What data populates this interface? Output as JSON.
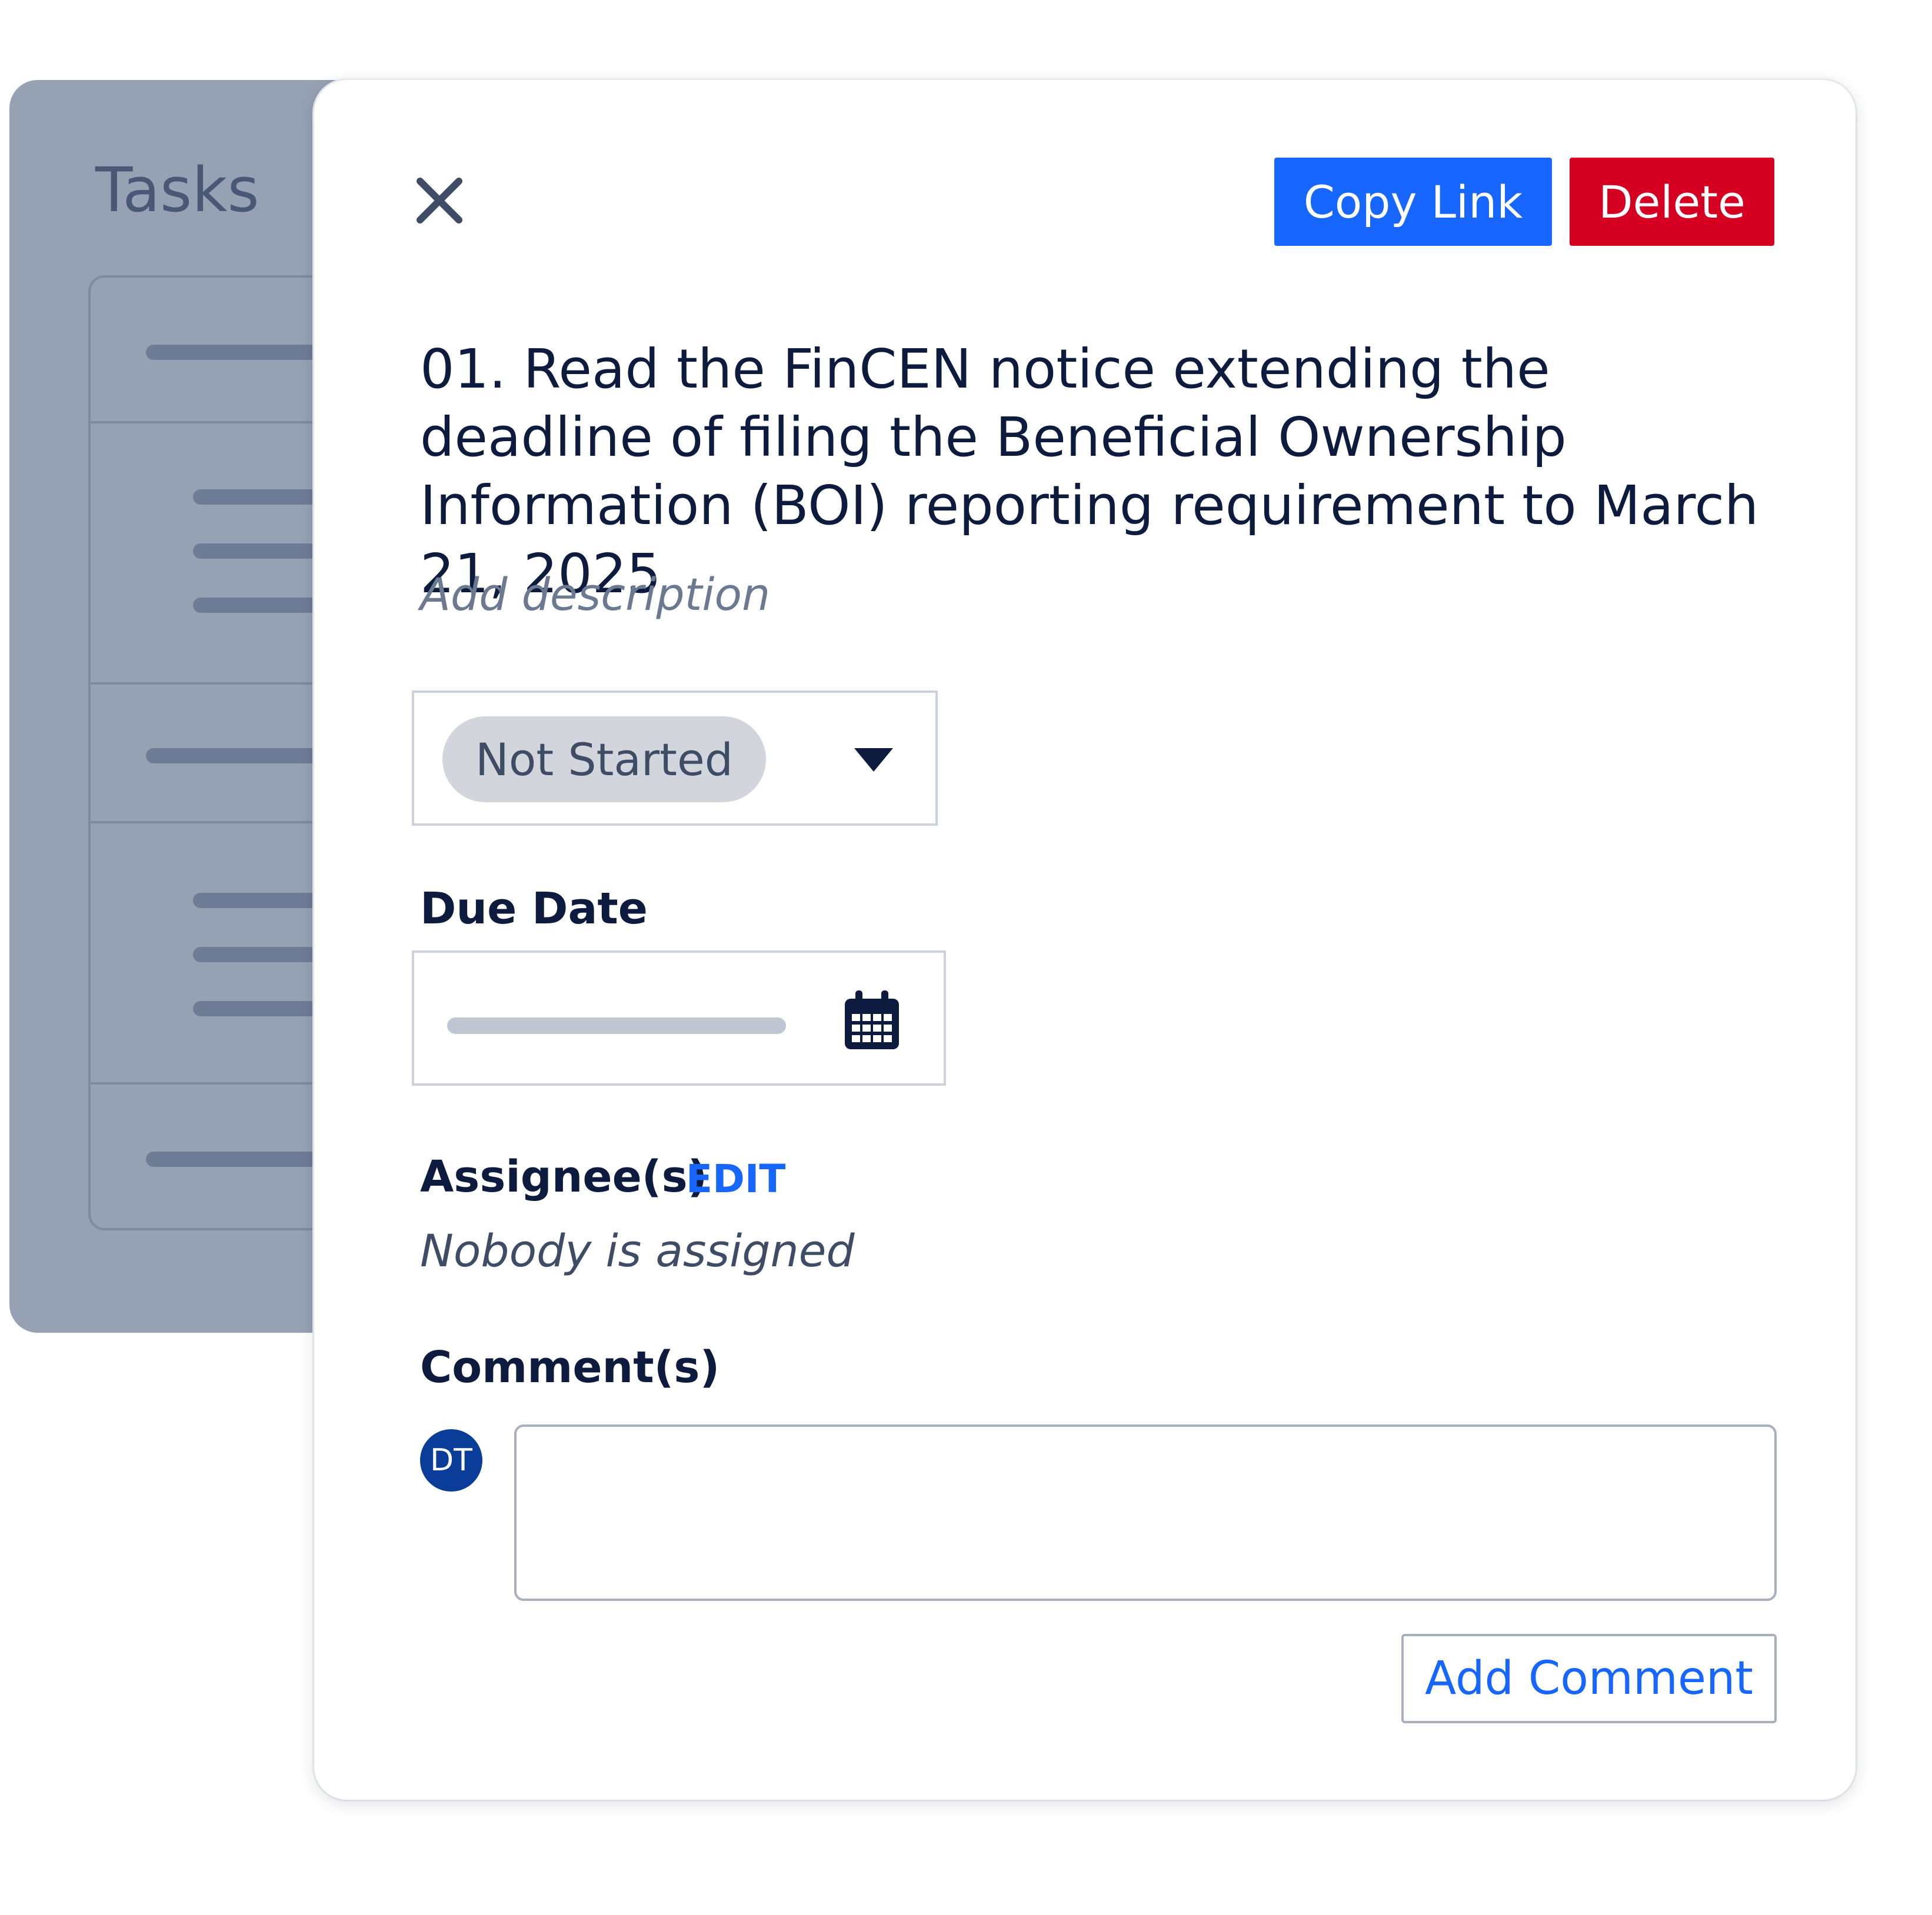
{
  "background_panel": {
    "title": "Tasks"
  },
  "toolbar": {
    "copy_link_label": "Copy Link",
    "delete_label": "Delete"
  },
  "task": {
    "title": "01. Read the FinCEN notice extending the deadline of filing the Beneficial Ownership Information (BOI) reporting requirement to March 21, 2025",
    "description_placeholder": "Add description"
  },
  "status": {
    "selected": "Not Started"
  },
  "due_date": {
    "label": "Due Date"
  },
  "assignees": {
    "label": "Assignee(s)",
    "edit_label": "EDIT",
    "empty_text": "Nobody is assigned"
  },
  "comments": {
    "label": "Comment(s)",
    "avatar_initials": "DT",
    "add_button_label": "Add Comment"
  },
  "colors": {
    "primary": "#1766ff",
    "danger": "#d50021",
    "text": "#0d1b3e",
    "avatar": "#0a3d99",
    "panel": "#96a1b3"
  }
}
